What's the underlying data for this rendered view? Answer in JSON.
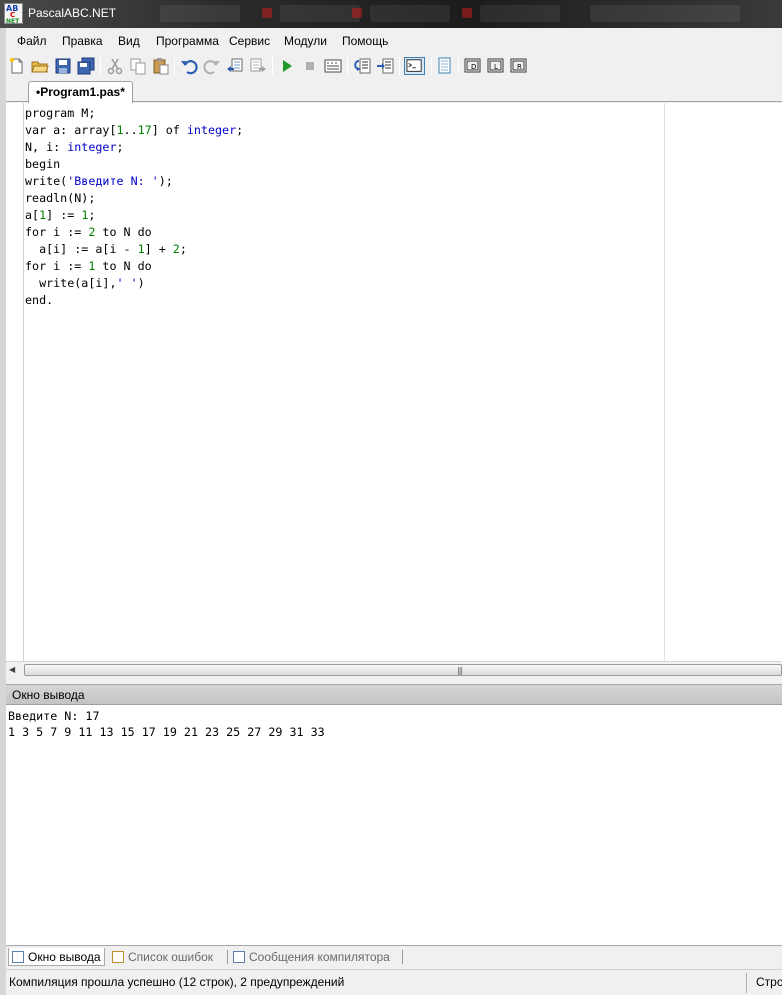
{
  "window": {
    "title": "PascalABC.NET",
    "icon_text": [
      "AB",
      "C",
      "NET"
    ]
  },
  "menu": [
    "Файл",
    "Правка",
    "Вид",
    "Программа",
    "Сервис",
    "Модули",
    "Помощь"
  ],
  "toolbar": {
    "icons": [
      "new-file-icon",
      "open-folder-icon",
      "save-icon",
      "save-all-icon",
      "cut-icon",
      "copy-icon",
      "paste-icon",
      "undo-icon",
      "redo-icon",
      "find-icon",
      "replace-icon",
      "run-icon",
      "stop-icon",
      "compile-icon",
      "step-into-icon",
      "step-over-icon",
      "output-window-icon",
      "debug-window-icon",
      "form-designer-icon",
      "tool-l-icon",
      "tool-r-icon"
    ]
  },
  "editor": {
    "tab_label": "•Program1.pas*",
    "lines": [
      "program M;",
      "var a: array[1..17] of integer;",
      "N, i: integer;",
      "begin",
      "write('Введите N: ');",
      "readln(N);",
      "a[1] := 1;",
      "for i := 2 to N do",
      "  a[i] := a[i - 1] + 2;",
      "for i := 1 to N do",
      "  write(a[i],' ')",
      "end."
    ]
  },
  "output": {
    "header": "Окно вывода",
    "lines": [
      "Введите N: 17",
      "1 3 5 7 9 11 13 15 17 19 21 23 25 27 29 31 33"
    ]
  },
  "bottom_tabs": [
    {
      "label": "Окно вывода",
      "active": true
    },
    {
      "label": "Список ошибок",
      "active": false
    },
    {
      "label": "Сообщения компилятора",
      "active": false
    }
  ],
  "status": {
    "message": "Компиляция прошла успешно (12 строк), 2 предупреждений",
    "right": "Стро"
  },
  "colors": {
    "keyword_type": "#0000c8",
    "number": "#008000",
    "string": "#0000c8"
  }
}
